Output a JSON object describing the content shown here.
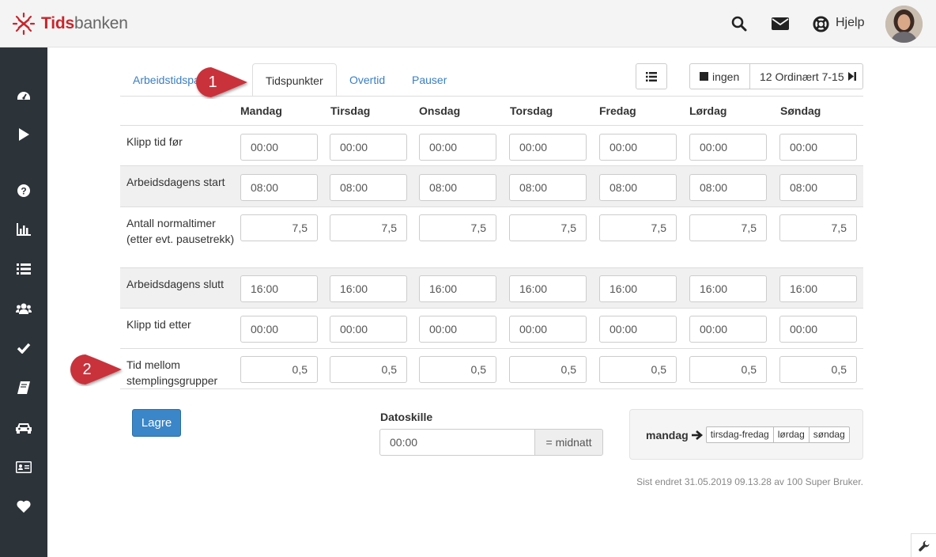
{
  "brand": {
    "name_part1": "Tids",
    "name_part2": "banken"
  },
  "topbar": {
    "help_label": "Hjelp"
  },
  "sidebar": {
    "icons": [
      "dashboard-icon",
      "play-icon",
      "question-icon",
      "bar-chart-icon",
      "list-icon",
      "users-icon",
      "check-icon",
      "book-icon",
      "car-icon",
      "id-card-icon",
      "heart-icon"
    ]
  },
  "tabs": [
    {
      "label": "Arbeidstidspa"
    },
    {
      "label": "Tidspunkter"
    },
    {
      "label": "Overtid"
    },
    {
      "label": "Pauser"
    }
  ],
  "controls": {
    "ingen_label": "ingen",
    "ordinary_label": "12 Ordinært 7-15"
  },
  "days": [
    "Mandag",
    "Tirsdag",
    "Onsdag",
    "Torsdag",
    "Fredag",
    "Lørdag",
    "Søndag"
  ],
  "rows": [
    {
      "label": "Klipp tid før",
      "values": [
        "00:00",
        "00:00",
        "00:00",
        "00:00",
        "00:00",
        "00:00",
        "00:00"
      ]
    },
    {
      "label": "Arbeidsdagens start",
      "values": [
        "08:00",
        "08:00",
        "08:00",
        "08:00",
        "08:00",
        "08:00",
        "08:00"
      ]
    },
    {
      "label": "Antall normaltimer (etter evt. pausetrekk)",
      "values": [
        "7,5",
        "7,5",
        "7,5",
        "7,5",
        "7,5",
        "7,5",
        "7,5"
      ]
    },
    {
      "label": "Arbeidsdagens slutt",
      "values": [
        "16:00",
        "16:00",
        "16:00",
        "16:00",
        "16:00",
        "16:00",
        "16:00"
      ]
    },
    {
      "label": "Klipp tid etter",
      "values": [
        "00:00",
        "00:00",
        "00:00",
        "00:00",
        "00:00",
        "00:00",
        "00:00"
      ]
    },
    {
      "label": "Tid mellom stemplingsgrupper",
      "values": [
        "0,5",
        "0,5",
        "0,5",
        "0,5",
        "0,5",
        "0,5",
        "0,5"
      ]
    }
  ],
  "markers": [
    "1",
    "2"
  ],
  "footer": {
    "save_label": "Lagre",
    "datoskille_label": "Datoskille",
    "datoskille_value": "00:00",
    "datoskille_addon": "= midnatt",
    "week_start": "mandag",
    "week_chips": [
      "tirsdag-fredag",
      "lørdag",
      "søndag"
    ],
    "last_changed": "Sist endret 31.05.2019 09.13.28 av 100 Super Bruker."
  },
  "colors": {
    "accent": "#3a86c8",
    "brand_red": "#c9252c",
    "sidebar": "#2c3339",
    "marker": "#c9323a"
  }
}
